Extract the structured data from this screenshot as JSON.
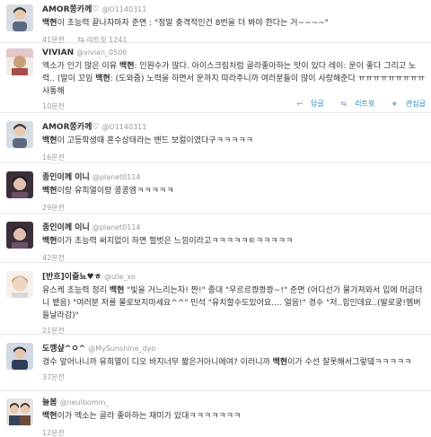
{
  "tweets": [
    {
      "name": "AMOR쫑카께♡",
      "handle": "@O1140311",
      "highlight": "백현",
      "text": "이 초능력 끝나자마자 준면 : \"정말 충격적인건 8번을 더 봐야 한다는 거~~~~\"",
      "time": "41분전",
      "retweet_icon": "retweet-icon",
      "retweet_label": "리트윗 1241"
    },
    {
      "name": "VIVIAN",
      "handle": "@vivian_0506",
      "line1": "엑소가 인기 많은 이유 ",
      "highlight": "백현",
      "line2": ": 인원수가 많다. 아이스크림처럼 골라좋아하는 맛이 있다 레이: 운이 좋다 그리고 노력.. (말이 꼬임 ",
      "highlight2": "백현",
      "line3": ": (도와줌) 노력을 하면서 운까지 따라주니까 여러분들이 많이 사랑해준다 ㅠㅠㅠㅠㅠㅠㅠㅠㅠ사통해",
      "time": "10분전",
      "reply_label": "답글",
      "retweet_label": "리트윗",
      "favorite_label": "관심글"
    },
    {
      "name": "AMOR쫑카께♡",
      "handle": "@O1140311",
      "highlight": "백현",
      "text": "이 고등학생때 혼수상태라는 밴드 보컬이였다구ㅋㅋㅋㅋㅋ",
      "time": "16분전"
    },
    {
      "name": "종인이께 이니",
      "handle": "@planet0114",
      "highlight": "백현",
      "text": "이랑 유희열이랑 콩콩엠ㅋㅋㅋㅋㅋ",
      "time": "29분전"
    },
    {
      "name": "종인이께 이니",
      "handle": "@planet0114",
      "highlight": "백현",
      "text": "이가 초능력 써지없이 하면 헐벗은 느낌이라고ㅋㅋㅋㅋㅋㅌㅋㅋㅋㅋㅋ",
      "time": "42분전"
    },
    {
      "name": "[반흐]이즐뇨♥ㅎ",
      "handle": "@izle_xo",
      "line1": "유스케 초능력 정리 ",
      "highlight": "백현",
      "line2": " \"빛을 거느리는자! 짠!\" 종대 \"우르르쾅쾅쾅~!\" 준면 (어디선가 물가져와서 입에 머금더니 뱉음) \"여러분 저를 물로보지마세요^^\" 민석 \"유치할수도있어요.... 얼음!\" 경수 \"저..힘인데요..(발로쿵!멤버들날라감)\"",
      "time": "21분전"
    },
    {
      "name": "도깽샾^ㅇ^",
      "handle": "@MySunshine_dyo",
      "line1": "경수 앞어나니까 유희열이 디오 바지너무 짧은거아니에여? 이러니까 ",
      "highlight": "백현",
      "line2": "이가 수선 잘못해서그렇댘ㅋㅋㅋㅋㅋ",
      "time": "37분전"
    },
    {
      "name": "늘봄",
      "handle": "@neulbomm_",
      "highlight": "백현",
      "text": "이가 엑소는 골라 좋아하는 재미가 있대ㅋㅋㅋㅋㅋㅋㅋ",
      "time": "12분전"
    }
  ],
  "colors": {
    "link": "#2a86c4",
    "muted": "#999999",
    "divider": "#e8e8e8"
  }
}
